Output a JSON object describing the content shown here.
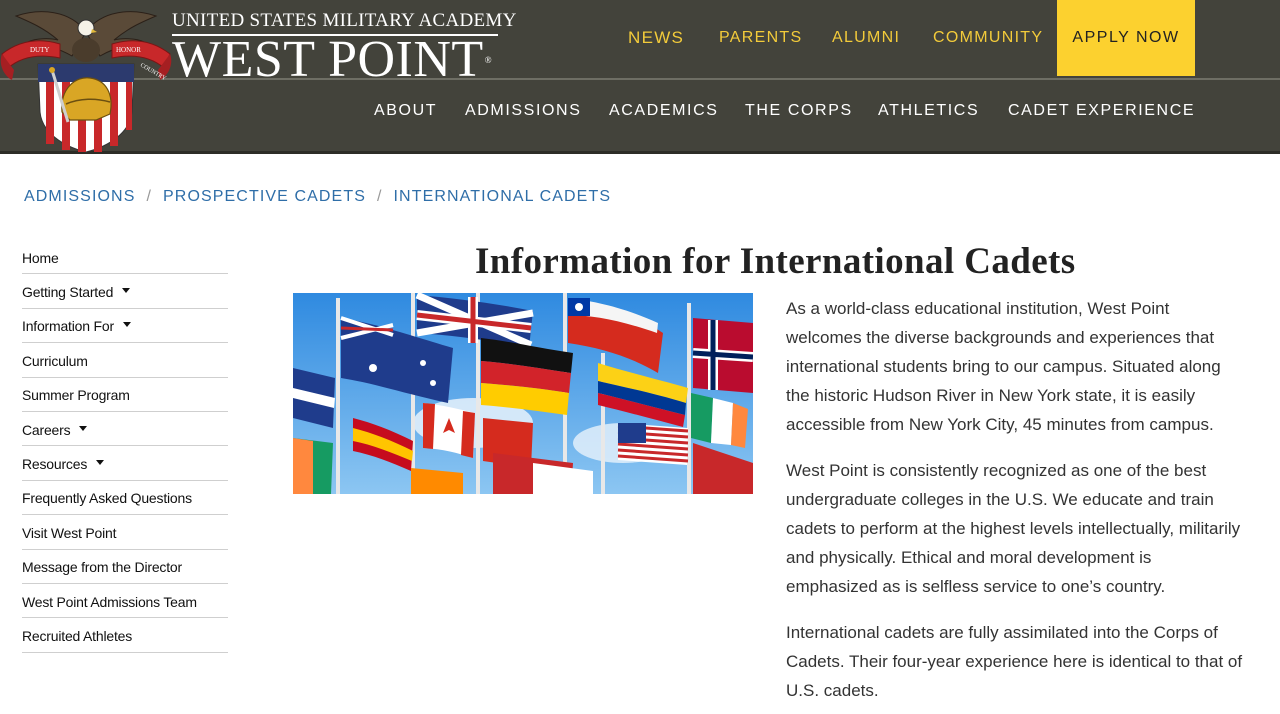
{
  "header": {
    "wordmark_sub": "UNITED STATES MILITARY ACADEMY",
    "wordmark_main": "WEST POINT",
    "registered_mark": "®",
    "crest_ribbon_left": "DUTY",
    "crest_ribbon_mid": "HONOR",
    "crest_ribbon_right": "COUNTRY",
    "top_nav": [
      "NEWS",
      "PARENTS",
      "ALUMNI",
      "COMMUNITY"
    ],
    "apply_label": "APPLY NOW",
    "main_nav": [
      "ABOUT",
      "ADMISSIONS",
      "ACADEMICS",
      "THE CORPS",
      "ATHLETICS",
      "CADET EXPERIENCE"
    ]
  },
  "breadcrumb": {
    "items": [
      "ADMISSIONS",
      "PROSPECTIVE CADETS",
      "INTERNATIONAL CADETS"
    ],
    "separator": "/"
  },
  "sidebar": {
    "items": [
      {
        "label": "Home",
        "has_dropdown": false
      },
      {
        "label": "Getting Started",
        "has_dropdown": true
      },
      {
        "label": "Information For",
        "has_dropdown": true
      },
      {
        "label": "Curriculum",
        "has_dropdown": false
      },
      {
        "label": "Summer Program",
        "has_dropdown": false
      },
      {
        "label": "Careers",
        "has_dropdown": true
      },
      {
        "label": "Resources",
        "has_dropdown": true
      },
      {
        "label": "Frequently Asked Questions",
        "has_dropdown": false
      },
      {
        "label": "Visit West Point",
        "has_dropdown": false
      },
      {
        "label": "Message from the Director",
        "has_dropdown": false
      },
      {
        "label": "West Point Admissions Team",
        "has_dropdown": false
      },
      {
        "label": "Recruited Athletes",
        "has_dropdown": false
      }
    ]
  },
  "main": {
    "title": "Information for International Cadets",
    "paragraphs": [
      "As a world-class educational institution, West Point welcomes the diverse backgrounds and experiences that international students bring to our campus. Situated along the historic Hudson River in New York state, it is easily accessible from New York City, 45 minutes from campus.",
      "West Point is consistently recognized as one of the best undergraduate colleges in the U.S. We educate and train cadets to perform at the highest levels intellectually, militarily and physically. Ethical and moral development is emphasized as is selfless service to one’s country.",
      "International cadets are fully assimilated into the Corps of Cadets. Their four-year experience here is identical to that of U.S. cadets."
    ]
  },
  "colors": {
    "header_bg": "#43433b",
    "top_nav_text": "#f3cb3a",
    "apply_bg": "#fcd12f",
    "breadcrumb_link": "#2f6ea8"
  },
  "icons": [
    "west-point-crest-icon",
    "eagle-icon",
    "helmet-icon",
    "caret-down-icon",
    "flags-photo"
  ]
}
